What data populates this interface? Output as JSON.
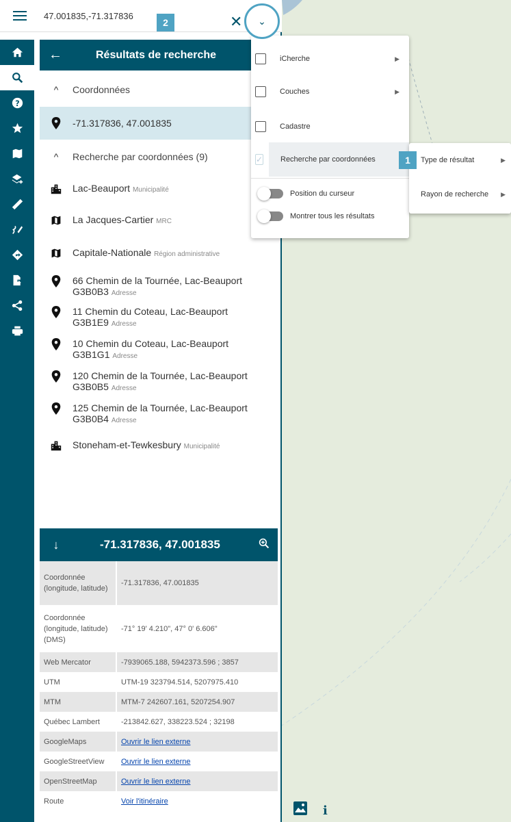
{
  "search": {
    "value": "47.001835,-71.317836",
    "badge": "2"
  },
  "results_header": {
    "title": "Résultats de recherche"
  },
  "groups": {
    "coordonnees": {
      "label": "Coordonnées"
    },
    "recherche": {
      "label": "Recherche par coordonnées (9)"
    }
  },
  "selected_result": {
    "text": "-71.317836, 47.001835"
  },
  "results": [
    {
      "name": "Lac-Beauport",
      "type": "Municipalité",
      "icon": "city-icon"
    },
    {
      "name": "La Jacques-Cartier",
      "type": "MRC",
      "icon": "map-icon"
    },
    {
      "name": "Capitale-Nationale",
      "type": "Région administrative",
      "icon": "map-icon"
    },
    {
      "name": "66 Chemin de la Tournée, Lac-Beauport",
      "line2": "G3B0B3",
      "type": "Adresse",
      "icon": "pin-icon"
    },
    {
      "name": "11 Chemin du Coteau, Lac-Beauport",
      "line2": "G3B1E9",
      "type": "Adresse",
      "icon": "pin-icon"
    },
    {
      "name": "10 Chemin du Coteau, Lac-Beauport",
      "line2": "G3B1G1",
      "type": "Adresse",
      "icon": "pin-icon"
    },
    {
      "name": "120 Chemin de la Tournée, Lac-Beauport",
      "line2": "G3B0B5",
      "type": "Adresse",
      "icon": "pin-icon"
    },
    {
      "name": "125 Chemin de la Tournée, Lac-Beauport",
      "line2": "G3B0B4",
      "type": "Adresse",
      "icon": "pin-icon"
    },
    {
      "name": "Stoneham-et-Tewkesbury",
      "type": "Municipalité",
      "icon": "city-icon"
    }
  ],
  "detail": {
    "title": "-71.317836, 47.001835",
    "rows": [
      {
        "key": "Coordonnée (longitude, latitude)",
        "value": "-71.317836, 47.001835"
      },
      {
        "key": "Coordonnée (longitude, latitude) (DMS)",
        "value": "-71° 19' 4.210\", 47° 0' 6.606\""
      },
      {
        "key": "Web Mercator",
        "value": "-7939065.188, 5942373.596 ; 3857"
      },
      {
        "key": "UTM",
        "value": "UTM-19 323794.514, 5207975.410"
      },
      {
        "key": "MTM",
        "value": "MTM-7 242607.161, 5207254.907"
      },
      {
        "key": "Québec Lambert",
        "value": "-213842.627, 338223.524 ; 32198"
      },
      {
        "key": "GoogleMaps",
        "link": "Ouvrir le lien externe"
      },
      {
        "key": "GoogleStreetView",
        "link": "Ouvrir le lien externe"
      },
      {
        "key": "OpenStreetMap",
        "link": "Ouvrir le lien externe"
      },
      {
        "key": "Route",
        "link": "Voir l'itinéraire"
      }
    ]
  },
  "menu": {
    "items": [
      {
        "label": "iCherche",
        "checked": false,
        "has_submenu": true
      },
      {
        "label": "Couches",
        "checked": false,
        "has_submenu": true
      },
      {
        "label": "Cadastre",
        "checked": false,
        "has_submenu": false
      },
      {
        "label": "Recherche par coordonnées",
        "checked": true,
        "has_submenu": false
      }
    ],
    "toggles": [
      {
        "label": "Position du curseur"
      },
      {
        "label": "Montrer tous les résultats"
      }
    ],
    "badge": "1"
  },
  "submenu": {
    "items": [
      {
        "label": "Type de résultat"
      },
      {
        "label": "Rayon de recherche"
      }
    ]
  },
  "map_controls": {
    "info_label": "i"
  },
  "colors": {
    "primary": "#00546b",
    "accent": "#4fa3c3",
    "selected_row": "#d5e8ee",
    "map_bg": "#e5ecdd"
  }
}
